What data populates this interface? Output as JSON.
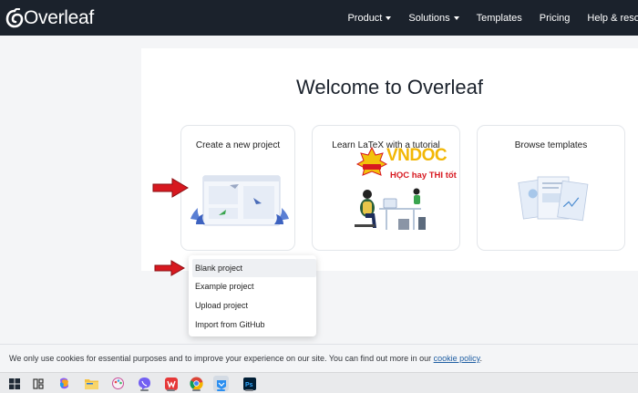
{
  "nav": {
    "logo_text": "Overleaf",
    "items": [
      {
        "label": "Product",
        "dropdown": true
      },
      {
        "label": "Solutions",
        "dropdown": true
      },
      {
        "label": "Templates",
        "dropdown": false
      },
      {
        "label": "Pricing",
        "dropdown": false
      },
      {
        "label": "Help & resou",
        "dropdown": false
      }
    ]
  },
  "main": {
    "title": "Welcome to Overleaf",
    "cards": [
      {
        "title": "Create a new project"
      },
      {
        "title": "Learn LaTeX with a tutorial"
      },
      {
        "title": "Browse templates"
      }
    ]
  },
  "watermark": {
    "brand": "VNDOC",
    "tagline": "HỌC hay THI tốt"
  },
  "dropdown": {
    "items": [
      "Blank project",
      "Example project",
      "Upload project",
      "Import from GitHub"
    ],
    "highlighted": "Blank project"
  },
  "cookie": {
    "text": "We only use cookies for essential purposes and to improve your experience on our site. You can find out more in our ",
    "link": "cookie policy",
    "suffix": "."
  },
  "taskbar": {
    "icons": [
      "windows-start-icon",
      "task-view-icon",
      "copilot-icon",
      "file-explorer-icon",
      "paint-icon",
      "viber-icon",
      "wps-office-icon",
      "chrome-icon",
      "edge-icon",
      "photoshop-icon"
    ]
  },
  "colors": {
    "nav_bg": "#1b222c",
    "accent_red": "#d71920",
    "link": "#1f5ea3"
  }
}
